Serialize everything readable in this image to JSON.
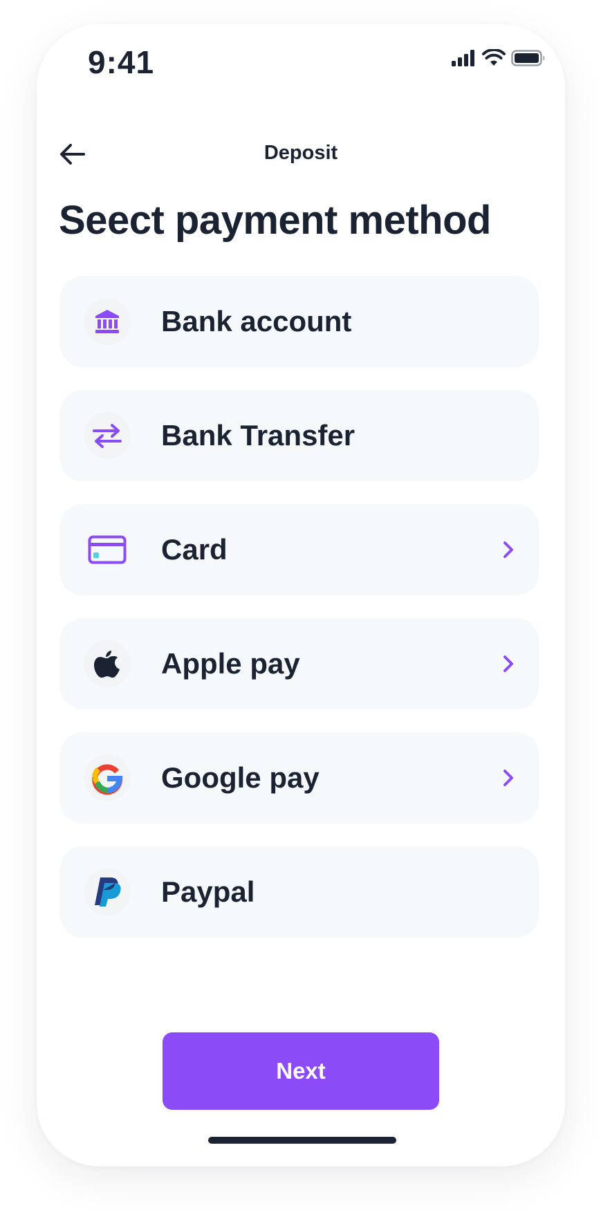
{
  "status_bar": {
    "time": "9:41",
    "icons": [
      "cellular-signal-icon",
      "wifi-icon",
      "battery-icon"
    ]
  },
  "header": {
    "title": "Deposit",
    "back_icon": "arrow-left-icon"
  },
  "page": {
    "heading": "Seect payment method"
  },
  "methods": [
    {
      "label": "Bank account",
      "icon": "bank-icon",
      "has_chevron": false
    },
    {
      "label": "Bank Transfer",
      "icon": "transfer-arrows-icon",
      "has_chevron": false
    },
    {
      "label": "Card",
      "icon": "credit-card-icon",
      "has_chevron": true
    },
    {
      "label": "Apple pay",
      "icon": "apple-logo-icon",
      "has_chevron": true
    },
    {
      "label": "Google pay",
      "icon": "google-logo-icon",
      "has_chevron": true
    },
    {
      "label": "Paypal",
      "icon": "paypal-logo-icon",
      "has_chevron": false
    }
  ],
  "footer": {
    "next_label": "Next"
  },
  "colors": {
    "accent": "#8b4cf7",
    "text": "#1b2333",
    "card_bg": "#f6f9fb",
    "icon_bg": "#f2f4f6",
    "card_chip": "#4fd1d9"
  }
}
